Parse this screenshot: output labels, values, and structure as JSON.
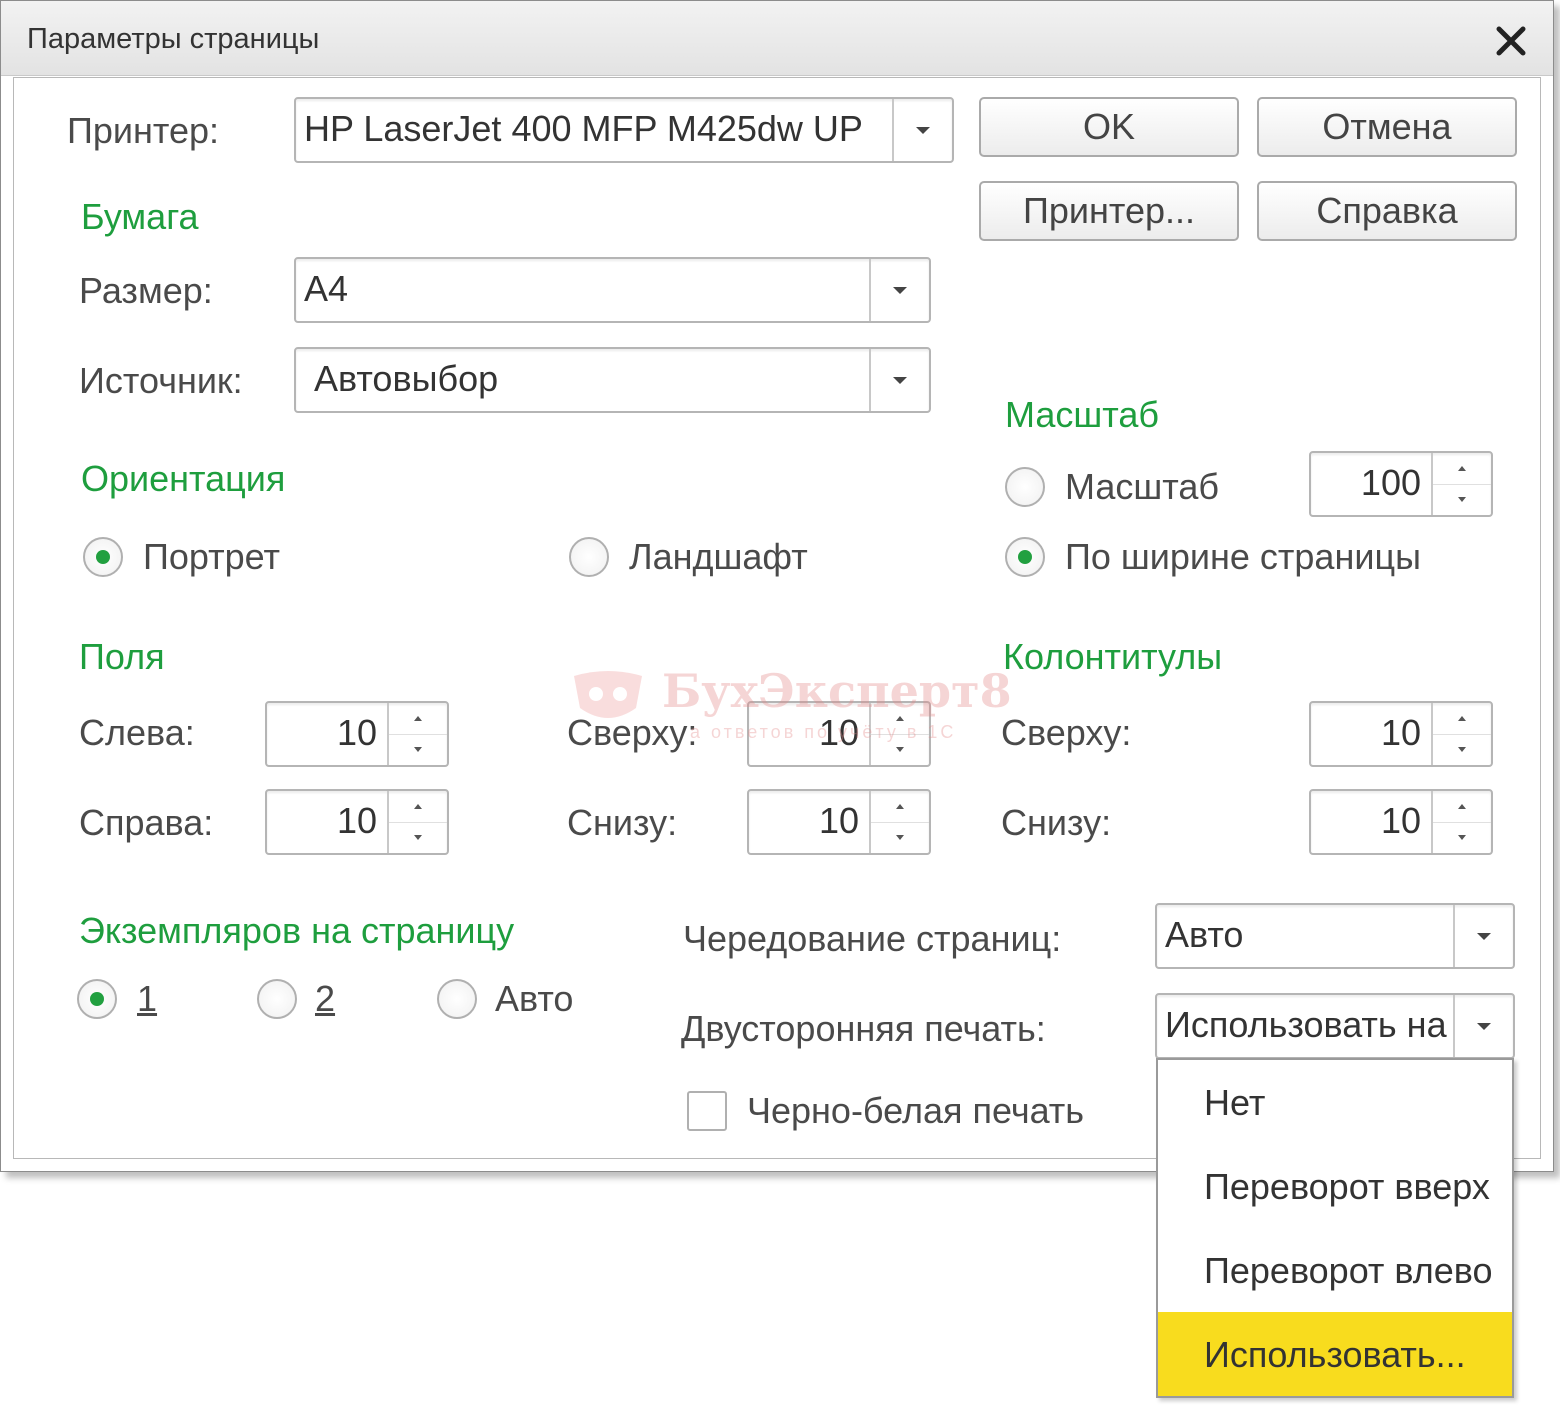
{
  "dialog": {
    "title": "Параметры страницы"
  },
  "printer": {
    "label": "Принтер:",
    "value": "HP LaserJet 400 MFP M425dw UP"
  },
  "buttons": {
    "ok": "OK",
    "cancel": "Отмена",
    "printer": "Принтер...",
    "help": "Справка"
  },
  "paper": {
    "title": "Бумага",
    "size_label": "Размер:",
    "size_value": "A4",
    "source_label": "Источник:",
    "source_value": "Автовыбор"
  },
  "orientation": {
    "title": "Ориентация",
    "portrait": "Портрет",
    "landscape": "Ландшафт",
    "selected": "portrait"
  },
  "scale": {
    "title": "Масштаб",
    "scale_option": "Масштаб",
    "scale_value": "100",
    "fit_width_option": "По ширине страницы",
    "selected": "fit_width"
  },
  "margins": {
    "title": "Поля",
    "left_label": "Слева:",
    "left_value": "10",
    "right_label": "Справа:",
    "right_value": "10",
    "top_label": "Сверху:",
    "top_value": "10",
    "bottom_label": "Снизу:",
    "bottom_value": "10"
  },
  "headers": {
    "title": "Колонтитулы",
    "top_label": "Сверху:",
    "top_value": "10",
    "bottom_label": "Снизу:",
    "bottom_value": "10"
  },
  "copies": {
    "title": "Экземпляров на страницу",
    "opt1": "1",
    "opt2": "2",
    "opt_auto": "Авто",
    "selected": "1"
  },
  "alternation": {
    "label": "Чередование страниц:",
    "value": "Авто"
  },
  "duplex": {
    "label": "Двусторонняя печать:",
    "value": "Использовать на",
    "options": [
      "Нет",
      "Переворот вверх",
      "Переворот влево",
      "Использовать..."
    ],
    "highlighted": "Использовать..."
  },
  "bw": {
    "label": "Черно-белая печать",
    "checked": false
  },
  "watermark": {
    "title": "БухЭксперт8",
    "subtitle": "а ответов по учёту в 1С"
  },
  "colors": {
    "group_title": "#1e9e3e",
    "radio_dot": "#22a040",
    "highlight": "#f8dc1e"
  }
}
